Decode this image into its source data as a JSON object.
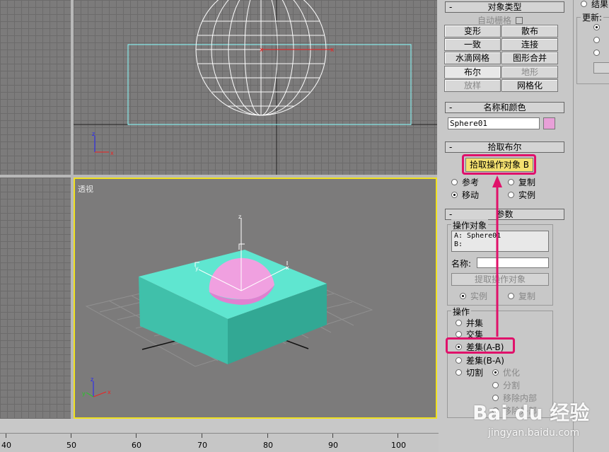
{
  "viewport_perspective": {
    "label": "透视"
  },
  "panel": {
    "object_type": {
      "header": "对象类型",
      "autogrid_label": "自动栅格",
      "buttons": [
        "变形",
        "散布",
        "一致",
        "连接",
        "水滴网格",
        "图形合并",
        "布尔",
        "地形",
        "放样",
        "网格化"
      ]
    },
    "name_color": {
      "header": "名称和颜色",
      "name_value": "Sphere01",
      "swatch_color": "#e8a0d8"
    },
    "pick_boolean": {
      "header": "拾取布尔",
      "pick_button": "拾取操作对象 B",
      "radio_reference": "参考",
      "radio_copy": "复制",
      "radio_move": "移动",
      "radio_instance": "实例"
    },
    "params": {
      "header": "参数",
      "operands_group": "操作对象",
      "operand_a": "A: Sphere01",
      "operand_b": "B:",
      "name_label": "名称:",
      "extract_button": "提取操作对象",
      "radio_instance": "实例",
      "radio_copy": "复制",
      "operation_group": "操作",
      "op_union": "并集",
      "op_intersection": "交集",
      "op_subtract_ab": "差集(A-B)",
      "op_subtract_ba": "差集(B-A)",
      "op_cut": "切割",
      "cut_refine": "优化",
      "cut_split": "分割",
      "cut_remove_inside": "移除内部",
      "cut_remove_outside": "移除外部"
    }
  },
  "right_strip": {
    "item1": "结果",
    "update_label": "更新:"
  },
  "ruler": {
    "labels": [
      "40",
      "50",
      "60",
      "70",
      "80",
      "90",
      "100"
    ]
  },
  "watermark": {
    "brand": "Bai du 经验",
    "url": "jingyan.baidu.com"
  },
  "colors": {
    "accent_highlight": "#e0116a",
    "active_viewport": "#f0e020",
    "box_color": "#4fd8c0",
    "sphere_color": "#f0a0e0"
  }
}
